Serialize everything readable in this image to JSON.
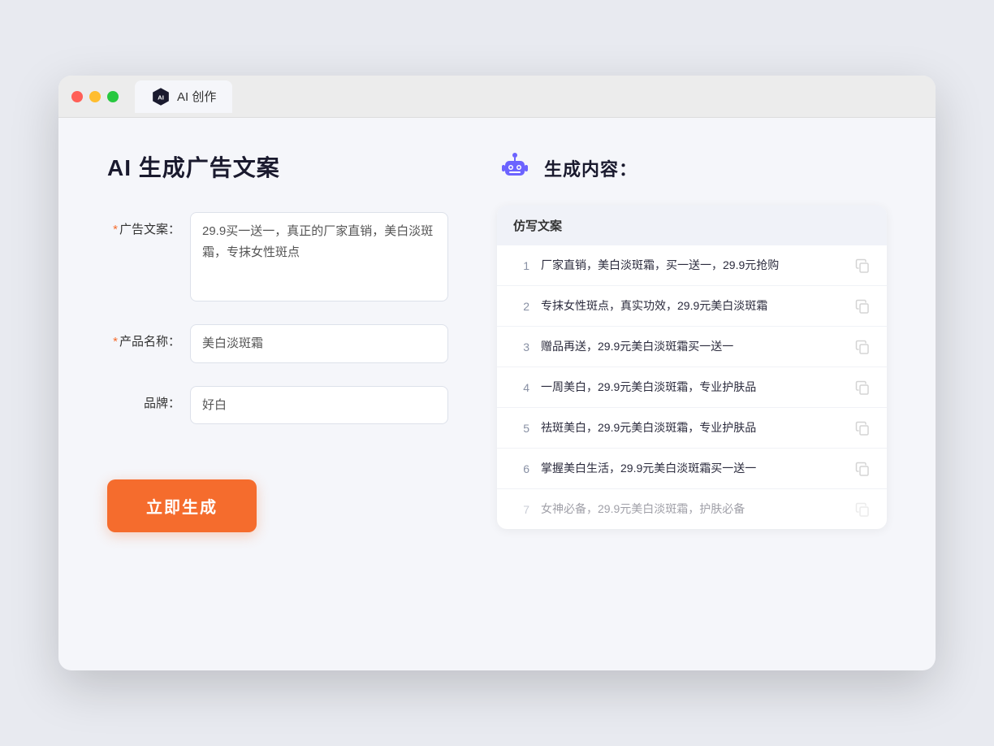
{
  "browser": {
    "tab_label": "AI 创作",
    "traffic_lights": [
      "red",
      "yellow",
      "green"
    ]
  },
  "page": {
    "title": "AI 生成广告文案",
    "right_title": "生成内容："
  },
  "form": {
    "ad_copy_label": "广告文案：",
    "ad_copy_required": "*",
    "ad_copy_value": "29.9买一送一，真正的厂家直销，美白淡斑霜，专抹女性斑点",
    "product_name_label": "产品名称：",
    "product_name_required": "*",
    "product_name_value": "美白淡斑霜",
    "brand_label": "品牌：",
    "brand_value": "好白",
    "generate_btn": "立即生成"
  },
  "results": {
    "header": "仿写文案",
    "items": [
      {
        "num": "1",
        "text": "厂家直销，美白淡斑霜，买一送一，29.9元抢购",
        "dimmed": false
      },
      {
        "num": "2",
        "text": "专抹女性斑点，真实功效，29.9元美白淡斑霜",
        "dimmed": false
      },
      {
        "num": "3",
        "text": "赠品再送，29.9元美白淡斑霜买一送一",
        "dimmed": false
      },
      {
        "num": "4",
        "text": "一周美白，29.9元美白淡斑霜，专业护肤品",
        "dimmed": false
      },
      {
        "num": "5",
        "text": "祛斑美白，29.9元美白淡斑霜，专业护肤品",
        "dimmed": false
      },
      {
        "num": "6",
        "text": "掌握美白生活，29.9元美白淡斑霜买一送一",
        "dimmed": false
      },
      {
        "num": "7",
        "text": "女神必备，29.9元美白淡斑霜，护肤必备",
        "dimmed": true
      }
    ]
  }
}
